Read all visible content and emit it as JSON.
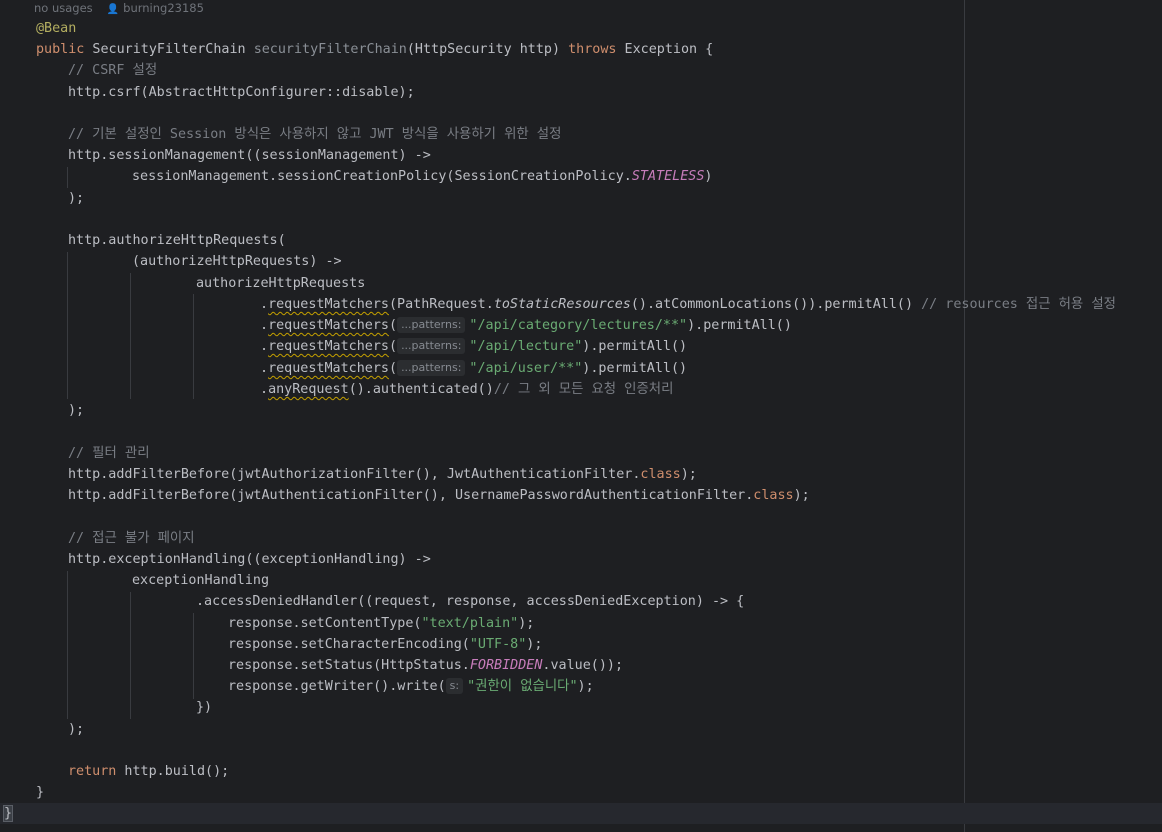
{
  "meta": {
    "usages": "no usages",
    "author": "burning23185"
  },
  "code": {
    "annotation": "@Bean",
    "kw_public": "public",
    "return_type": " SecurityFilterChain ",
    "method_name": "securityFilterChain",
    "params": "(HttpSecurity http) ",
    "kw_throws": "throws",
    "throws_rest": " Exception {",
    "comment_csrf": "// CSRF 설정",
    "csrf": "http.csrf(AbstractHttpConfigurer::disable);",
    "comment_session": "// 기본 설정인 Session 방식은 사용하지 않고 JWT 방식을 사용하기 위한 설정",
    "session_a": "http.sessionManagement((sessionManagement) ->",
    "session_b1": "sessionManagement.sessionCreationPolicy(SessionCreationPolicy.",
    "session_static": "STATELESS",
    "session_b2": ")",
    "close_paren": ");",
    "auth_a": "http.authorizeHttpRequests(",
    "auth_b": "(authorizeHttpRequests) ->",
    "auth_c": "authorizeHttpRequests",
    "dot": ".",
    "request_matchers": "requestMatchers",
    "rm1_a": "(PathRequest.",
    "rm1_ital": "toStaticResources",
    "rm1_b": "().atCommonLocations()).permitAll() ",
    "rm1_comment": "// resources 접근 허용 설정",
    "open_paren": "(",
    "patterns_hint": "...patterns:",
    "rm2_str": "\"/api/category/lectures/**\"",
    "rm3_str": "\"/api/lecture\"",
    "rm4_str": "\"/api/user/**\"",
    "permit_all_end": ").permitAll()",
    "any_request": "anyRequest",
    "authenticated": "().authenticated()",
    "comment_rest": "// 그 외 모든 요청 인증처리",
    "comment_filter": "// 필터 관리",
    "filter1_a": "http.addFilterBefore(jwtAuthorizationFilter(), JwtAuthenticationFilter.",
    "kw_class": "class",
    "semi_end": ");",
    "filter2_a": "http.addFilterBefore(jwtAuthenticationFilter(), UsernamePasswordAuthenticationFilter.",
    "comment_denied": "// 접근 불가 페이지",
    "exc_a": "http.exceptionHandling((exceptionHandling) ->",
    "exc_b": "exceptionHandling",
    "exc_c": ".accessDeniedHandler((request, response, accessDeniedException) -> {",
    "resp1_a": "response.setContentType(",
    "resp1_str": "\"text/plain\"",
    "resp2_a": "response.setCharacterEncoding(",
    "resp2_str": "\"UTF-8\"",
    "resp3_a": "response.setStatus(HttpStatus.",
    "resp3_static": "FORBIDDEN",
    "resp3_b": ".value());",
    "resp4_a": "response.getWriter().write(",
    "s_hint": "s:",
    "resp4_str": "\"권한이 없습니다\"",
    "lambda_close": "})",
    "kw_return": "return",
    "return_rest": " http.build();",
    "method_close": "}",
    "class_close": "}"
  },
  "colors": {
    "background": "#1e1f22",
    "keyword": "#cf8e6d",
    "annotation": "#b3ae60",
    "comment": "#7a7e85",
    "string": "#6aab73",
    "static_field": "#c77dbb",
    "method_declaration": "#56a8f5"
  }
}
